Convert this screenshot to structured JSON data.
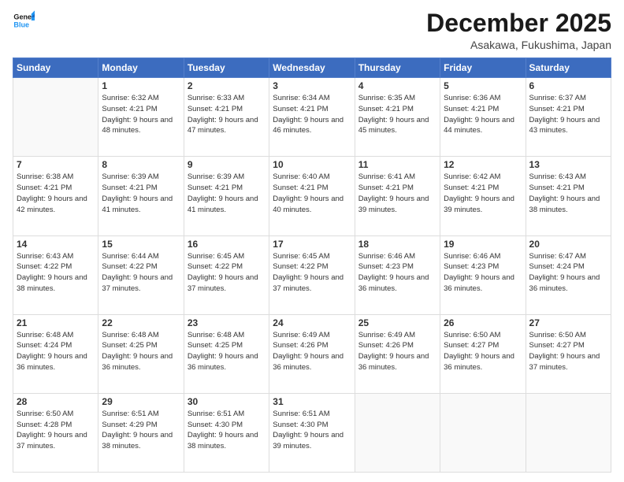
{
  "header": {
    "logo_line1": "General",
    "logo_line2": "Blue",
    "month": "December 2025",
    "location": "Asakawa, Fukushima, Japan"
  },
  "days_of_week": [
    "Sunday",
    "Monday",
    "Tuesday",
    "Wednesday",
    "Thursday",
    "Friday",
    "Saturday"
  ],
  "weeks": [
    [
      {
        "day": "",
        "info": ""
      },
      {
        "day": "1",
        "info": "Sunrise: 6:32 AM\nSunset: 4:21 PM\nDaylight: 9 hours\nand 48 minutes."
      },
      {
        "day": "2",
        "info": "Sunrise: 6:33 AM\nSunset: 4:21 PM\nDaylight: 9 hours\nand 47 minutes."
      },
      {
        "day": "3",
        "info": "Sunrise: 6:34 AM\nSunset: 4:21 PM\nDaylight: 9 hours\nand 46 minutes."
      },
      {
        "day": "4",
        "info": "Sunrise: 6:35 AM\nSunset: 4:21 PM\nDaylight: 9 hours\nand 45 minutes."
      },
      {
        "day": "5",
        "info": "Sunrise: 6:36 AM\nSunset: 4:21 PM\nDaylight: 9 hours\nand 44 minutes."
      },
      {
        "day": "6",
        "info": "Sunrise: 6:37 AM\nSunset: 4:21 PM\nDaylight: 9 hours\nand 43 minutes."
      }
    ],
    [
      {
        "day": "7",
        "info": "Sunrise: 6:38 AM\nSunset: 4:21 PM\nDaylight: 9 hours\nand 42 minutes."
      },
      {
        "day": "8",
        "info": "Sunrise: 6:39 AM\nSunset: 4:21 PM\nDaylight: 9 hours\nand 41 minutes."
      },
      {
        "day": "9",
        "info": "Sunrise: 6:39 AM\nSunset: 4:21 PM\nDaylight: 9 hours\nand 41 minutes."
      },
      {
        "day": "10",
        "info": "Sunrise: 6:40 AM\nSunset: 4:21 PM\nDaylight: 9 hours\nand 40 minutes."
      },
      {
        "day": "11",
        "info": "Sunrise: 6:41 AM\nSunset: 4:21 PM\nDaylight: 9 hours\nand 39 minutes."
      },
      {
        "day": "12",
        "info": "Sunrise: 6:42 AM\nSunset: 4:21 PM\nDaylight: 9 hours\nand 39 minutes."
      },
      {
        "day": "13",
        "info": "Sunrise: 6:43 AM\nSunset: 4:21 PM\nDaylight: 9 hours\nand 38 minutes."
      }
    ],
    [
      {
        "day": "14",
        "info": "Sunrise: 6:43 AM\nSunset: 4:22 PM\nDaylight: 9 hours\nand 38 minutes."
      },
      {
        "day": "15",
        "info": "Sunrise: 6:44 AM\nSunset: 4:22 PM\nDaylight: 9 hours\nand 37 minutes."
      },
      {
        "day": "16",
        "info": "Sunrise: 6:45 AM\nSunset: 4:22 PM\nDaylight: 9 hours\nand 37 minutes."
      },
      {
        "day": "17",
        "info": "Sunrise: 6:45 AM\nSunset: 4:22 PM\nDaylight: 9 hours\nand 37 minutes."
      },
      {
        "day": "18",
        "info": "Sunrise: 6:46 AM\nSunset: 4:23 PM\nDaylight: 9 hours\nand 36 minutes."
      },
      {
        "day": "19",
        "info": "Sunrise: 6:46 AM\nSunset: 4:23 PM\nDaylight: 9 hours\nand 36 minutes."
      },
      {
        "day": "20",
        "info": "Sunrise: 6:47 AM\nSunset: 4:24 PM\nDaylight: 9 hours\nand 36 minutes."
      }
    ],
    [
      {
        "day": "21",
        "info": "Sunrise: 6:48 AM\nSunset: 4:24 PM\nDaylight: 9 hours\nand 36 minutes."
      },
      {
        "day": "22",
        "info": "Sunrise: 6:48 AM\nSunset: 4:25 PM\nDaylight: 9 hours\nand 36 minutes."
      },
      {
        "day": "23",
        "info": "Sunrise: 6:48 AM\nSunset: 4:25 PM\nDaylight: 9 hours\nand 36 minutes."
      },
      {
        "day": "24",
        "info": "Sunrise: 6:49 AM\nSunset: 4:26 PM\nDaylight: 9 hours\nand 36 minutes."
      },
      {
        "day": "25",
        "info": "Sunrise: 6:49 AM\nSunset: 4:26 PM\nDaylight: 9 hours\nand 36 minutes."
      },
      {
        "day": "26",
        "info": "Sunrise: 6:50 AM\nSunset: 4:27 PM\nDaylight: 9 hours\nand 36 minutes."
      },
      {
        "day": "27",
        "info": "Sunrise: 6:50 AM\nSunset: 4:27 PM\nDaylight: 9 hours\nand 37 minutes."
      }
    ],
    [
      {
        "day": "28",
        "info": "Sunrise: 6:50 AM\nSunset: 4:28 PM\nDaylight: 9 hours\nand 37 minutes."
      },
      {
        "day": "29",
        "info": "Sunrise: 6:51 AM\nSunset: 4:29 PM\nDaylight: 9 hours\nand 38 minutes."
      },
      {
        "day": "30",
        "info": "Sunrise: 6:51 AM\nSunset: 4:30 PM\nDaylight: 9 hours\nand 38 minutes."
      },
      {
        "day": "31",
        "info": "Sunrise: 6:51 AM\nSunset: 4:30 PM\nDaylight: 9 hours\nand 39 minutes."
      },
      {
        "day": "",
        "info": ""
      },
      {
        "day": "",
        "info": ""
      },
      {
        "day": "",
        "info": ""
      }
    ]
  ]
}
